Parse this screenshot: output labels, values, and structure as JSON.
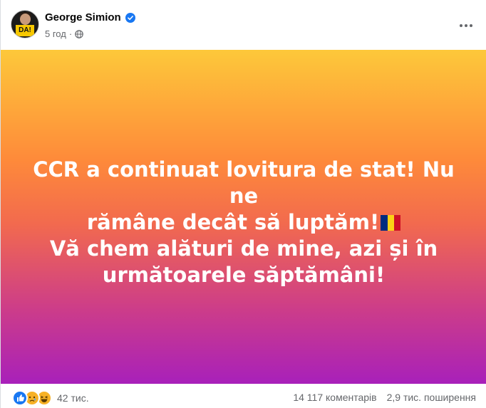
{
  "post": {
    "author": "George Simion",
    "time": "5 год",
    "separator": "·",
    "avatar_badge": "DA!",
    "text_lines": [
      "CCR a continuat lovitura de stat! Nu ne",
      "rămâne decât să luptăm!",
      "Vă chem alături de mine, azi și în",
      "următoarele săptămâni!"
    ],
    "flag_colors": [
      "#002b7f",
      "#fcd116",
      "#ce1126"
    ]
  },
  "footer": {
    "reactions": [
      "like-icon",
      "sad-icon",
      "haha-icon"
    ],
    "reaction_count": "42 тис.",
    "comments": "14 117 коментарів",
    "shares": "2,9 тис. поширення"
  },
  "colors": {
    "gradient_top": "#fdc83a",
    "gradient_mid": "#f26a4e",
    "gradient_bottom": "#a820ba",
    "verified": "#1877f2"
  }
}
